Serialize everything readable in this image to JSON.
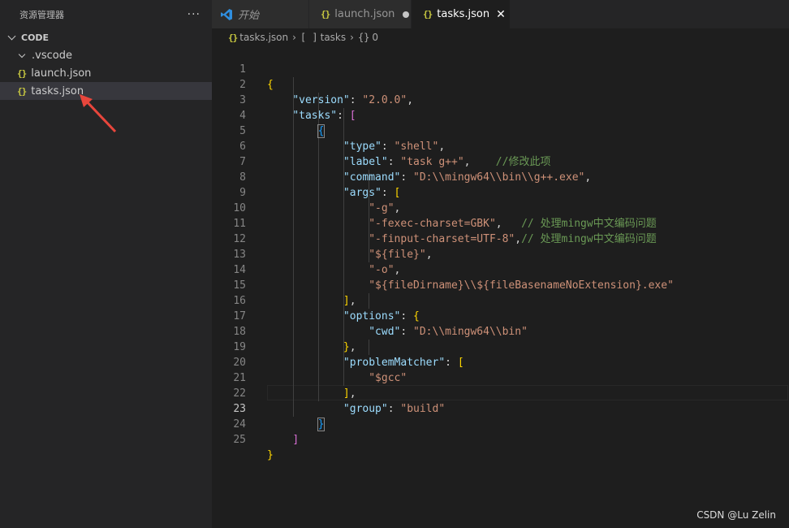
{
  "sidebar": {
    "title": "资源管理器",
    "more": "···",
    "section": "CODE",
    "items": [
      {
        "label": ".vscode",
        "kind": "folder"
      },
      {
        "label": "launch.json",
        "kind": "file"
      },
      {
        "label": "tasks.json",
        "kind": "file",
        "selected": true
      }
    ]
  },
  "tabs": [
    {
      "label": "开始",
      "icon": "vscode-icon"
    },
    {
      "label": "launch.json",
      "icon": "json-icon",
      "modified": true
    },
    {
      "label": "tasks.json",
      "icon": "json-icon",
      "active": true
    }
  ],
  "icons": {
    "json": "{}",
    "close": "✕",
    "chevron": "›"
  },
  "breadcrumb": [
    {
      "sym": "{}",
      "label": "tasks.json"
    },
    {
      "sym": "[ ]",
      "label": "tasks"
    },
    {
      "sym": "{}",
      "label": "0"
    }
  ],
  "editor": {
    "current_line": 23,
    "lines": [
      {
        "n": "1"
      },
      {
        "n": "2"
      },
      {
        "n": "3"
      },
      {
        "n": "4"
      },
      {
        "n": "5"
      },
      {
        "n": "6"
      },
      {
        "n": "7"
      },
      {
        "n": "8"
      },
      {
        "n": "9"
      },
      {
        "n": "10"
      },
      {
        "n": "11"
      },
      {
        "n": "12"
      },
      {
        "n": "13"
      },
      {
        "n": "14"
      },
      {
        "n": "15"
      },
      {
        "n": "16"
      },
      {
        "n": "17"
      },
      {
        "n": "18"
      },
      {
        "n": "19"
      },
      {
        "n": "20"
      },
      {
        "n": "21"
      },
      {
        "n": "22"
      },
      {
        "n": "23"
      },
      {
        "n": "24"
      },
      {
        "n": "25"
      }
    ],
    "tokens": {
      "l2_key": "\"version\"",
      "l2_val": "\"2.0.0\"",
      "l3_key": "\"tasks\"",
      "l5_key": "\"type\"",
      "l5_val": "\"shell\"",
      "l6_key": "\"label\"",
      "l6_val": "\"task g++\"",
      "l6_comment": "//修改此项",
      "l7_key": "\"command\"",
      "l7_val": "\"D:\\\\mingw64\\\\bin\\\\g++.exe\"",
      "l8_key": "\"args\"",
      "l9_val": "\"-g\"",
      "l10_val": "\"-fexec-charset=GBK\"",
      "l10_comment": "// 处理mingw中文编码问题",
      "l11_val": "\"-finput-charset=UTF-8\"",
      "l11_comment": "// 处理mingw中文编码问题",
      "l12_val": "\"${file}\"",
      "l13_val": "\"-o\"",
      "l14_val": "\"${fileDirname}\\\\${fileBasenameNoExtension}.exe\"",
      "l16_key": "\"options\"",
      "l17_key": "\"cwd\"",
      "l17_val": "\"D:\\\\mingw64\\\\bin\"",
      "l19_key": "\"problemMatcher\"",
      "l20_val": "\"$gcc\"",
      "l22_key": "\"group\"",
      "l22_val": "\"build\""
    }
  },
  "watermark": "CSDN @Lu Zelin",
  "colors": {
    "accent_arrow": "#e8463c",
    "key": "#9cdcfe",
    "string": "#ce9178",
    "comment": "#6a9955",
    "bracket_level1": "#ffd700",
    "bracket_level2": "#da70d6",
    "bracket_level3": "#179fff"
  }
}
